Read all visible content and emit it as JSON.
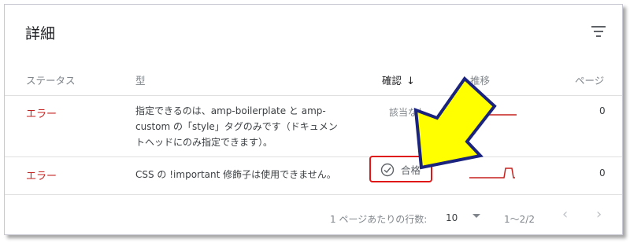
{
  "card": {
    "title": "詳細"
  },
  "table": {
    "headers": {
      "status": "ステータス",
      "type": "型",
      "confirm": "確認",
      "trend": "推移",
      "pages": "ページ"
    },
    "sort_icon": "arrow-down-icon",
    "rows": [
      {
        "status": "エラー",
        "type": "指定できるのは、amp-boilerplate と amp-custom の「style」タグのみです（ドキュメントヘッドにのみ指定できます）。",
        "confirm": "該当なし",
        "pages": "0"
      },
      {
        "status": "エラー",
        "type": "CSS の !important 修飾子は使用できません。",
        "confirm": "合格",
        "pages": "0"
      }
    ]
  },
  "pagination": {
    "rows_per_page_label": "1 ページあたりの行数:",
    "rows_per_page_value": "10",
    "range": "1〜2/2",
    "prev_icon": "chevron-left-icon",
    "next_icon": "chevron-right-icon"
  },
  "colors": {
    "error": "#c5221f",
    "sparkline": "#c5221f",
    "highlight_border": "#e01717",
    "arrow_fill": "#ffff00",
    "arrow_stroke": "#1a237e"
  }
}
